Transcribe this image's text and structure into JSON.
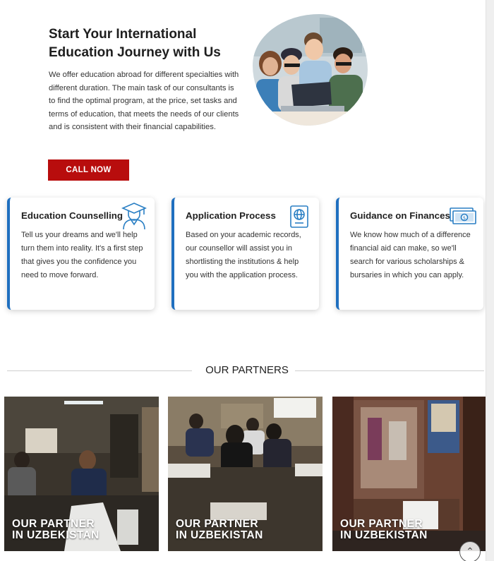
{
  "hero": {
    "title_line1": "Start Your International",
    "title_line2": "Education Journey with Us",
    "description": "We offer education abroad for different specialties with different duration. The main task of our consultants is to find the optimal program, at the price, set tasks and terms of education, that meets the needs of our clients and is consistent with their financial capabilities.",
    "cta_label": "CALL NOW",
    "photo_icon": "students-group-photo"
  },
  "services": [
    {
      "title": "Education Counselling",
      "text": "Tell us your dreams and we'll help turn them into reality. It's a first step that gives you the confidence you need to move forward.",
      "icon": "graduate-icon"
    },
    {
      "title": "Application Process",
      "text": "Based on your academic records, our counsellor will assist you in shortlisting the institutions & help you with the application process.",
      "icon": "passport-icon"
    },
    {
      "title": "Guidance on Finances",
      "text": "We know how much of a difference financial aid can make, so we'll search for various scholarships & bursaries in which you can apply.",
      "icon": "money-icon"
    }
  ],
  "partners": {
    "heading": "OUR PARTNERS",
    "items": [
      {
        "line1": "OUR PARTNER",
        "line2": "IN UZBEKISTAN"
      },
      {
        "line1": "OUR PARTNER",
        "line2": "IN UZBEKISTAN"
      },
      {
        "line1": "OUR PARTNER",
        "line2": "IN UZBEKISTAN"
      }
    ]
  },
  "scroll_top_icon": "chevron-up-icon",
  "colors": {
    "accent_red": "#b80d0d",
    "card_border_blue": "#1f6fbf",
    "icon_blue": "#2a7fc4"
  }
}
